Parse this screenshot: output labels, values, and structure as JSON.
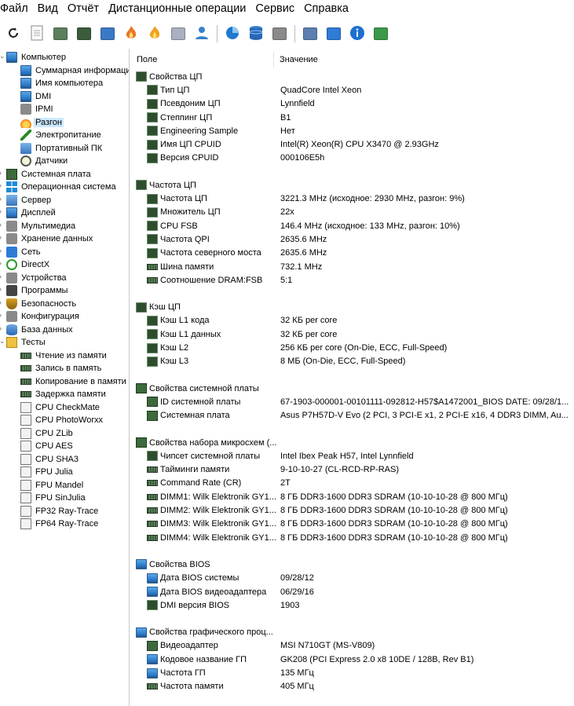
{
  "menu": [
    "Файл",
    "Вид",
    "Отчёт",
    "Дистанционные операции",
    "Сервис",
    "Справка"
  ],
  "toolbar": [
    {
      "icon": "refresh-icon"
    },
    {
      "icon": "report-icon"
    },
    {
      "icon": "chip-icon"
    },
    {
      "icon": "ram-icon"
    },
    {
      "icon": "network-icon"
    },
    {
      "icon": "fire-icon"
    },
    {
      "icon": "flame-icon"
    },
    {
      "icon": "printer-icon"
    },
    {
      "icon": "user-icon"
    },
    {
      "icon": "pie-chart-icon"
    },
    {
      "icon": "database-icon"
    },
    {
      "icon": "calendar-clock-icon"
    },
    {
      "icon": "list-report-icon"
    },
    {
      "icon": "update-icon"
    },
    {
      "icon": "info-icon"
    },
    {
      "icon": "network-check-icon"
    }
  ],
  "tree": [
    {
      "label": "Компьютер",
      "level": 0,
      "icon": "monitor",
      "expand": "v"
    },
    {
      "label": "Суммарная информаци",
      "level": 1,
      "icon": "monitor"
    },
    {
      "label": "Имя компьютера",
      "level": 1,
      "icon": "monitor"
    },
    {
      "label": "DMI",
      "level": 1,
      "icon": "monitor"
    },
    {
      "label": "IPMI",
      "level": 1,
      "icon": "gray"
    },
    {
      "label": "Разгон",
      "level": 1,
      "icon": "fire",
      "selected": true
    },
    {
      "label": "Электропитание",
      "level": 1,
      "icon": "bolt"
    },
    {
      "label": "Портативный ПК",
      "level": 1,
      "icon": "pc"
    },
    {
      "label": "Датчики",
      "level": 1,
      "icon": "clock"
    },
    {
      "label": "Системная плата",
      "level": 0,
      "icon": "board",
      "expand": ">"
    },
    {
      "label": "Операционная система",
      "level": 0,
      "icon": "win",
      "expand": ">"
    },
    {
      "label": "Сервер",
      "level": 0,
      "icon": "pc",
      "expand": ">"
    },
    {
      "label": "Дисплей",
      "level": 0,
      "icon": "monitor",
      "expand": ">"
    },
    {
      "label": "Мультимедиа",
      "level": 0,
      "icon": "gray",
      "expand": ">"
    },
    {
      "label": "Хранение данных",
      "level": 0,
      "icon": "gray",
      "expand": ">"
    },
    {
      "label": "Сеть",
      "level": 0,
      "icon": "blue",
      "expand": ">"
    },
    {
      "label": "DirectX",
      "level": 0,
      "icon": "green-circle",
      "expand": ">"
    },
    {
      "label": "Устройства",
      "level": 0,
      "icon": "gray",
      "expand": ">"
    },
    {
      "label": "Программы",
      "level": 0,
      "icon": "camera",
      "expand": ">"
    },
    {
      "label": "Безопасность",
      "level": 0,
      "icon": "shield",
      "expand": ">"
    },
    {
      "label": "Конфигурация",
      "level": 0,
      "icon": "gray",
      "expand": ">"
    },
    {
      "label": "База данных",
      "level": 0,
      "icon": "db",
      "expand": ">"
    },
    {
      "label": "Тесты",
      "level": 0,
      "icon": "yellow",
      "expand": "v"
    },
    {
      "label": "Чтение из памяти",
      "level": 1,
      "icon": "ram"
    },
    {
      "label": "Запись в память",
      "level": 1,
      "icon": "ram"
    },
    {
      "label": "Копирование в памяти",
      "level": 1,
      "icon": "ram"
    },
    {
      "label": "Задержка памяти",
      "level": 1,
      "icon": "ram"
    },
    {
      "label": "CPU CheckMate",
      "level": 1,
      "icon": "cpu-test"
    },
    {
      "label": "CPU PhotoWorxx",
      "level": 1,
      "icon": "cpu-test"
    },
    {
      "label": "CPU ZLib",
      "level": 1,
      "icon": "cpu-test"
    },
    {
      "label": "CPU AES",
      "level": 1,
      "icon": "cpu-test"
    },
    {
      "label": "CPU SHA3",
      "level": 1,
      "icon": "cpu-test"
    },
    {
      "label": "FPU Julia",
      "level": 1,
      "icon": "fpu-test"
    },
    {
      "label": "FPU Mandel",
      "level": 1,
      "icon": "fpu-test"
    },
    {
      "label": "FPU SinJulia",
      "level": 1,
      "icon": "fpu-test"
    },
    {
      "label": "FP32 Ray-Trace",
      "level": 1,
      "icon": "fpu-test"
    },
    {
      "label": "FP64 Ray-Trace",
      "level": 1,
      "icon": "fpu-test"
    }
  ],
  "columns": {
    "field": "Поле",
    "value": "Значение"
  },
  "groups": [
    {
      "title": "Свойства ЦП",
      "icon": "chip",
      "rows": [
        {
          "field": "Тип ЦП",
          "value": "QuadCore Intel Xeon",
          "icon": "chip"
        },
        {
          "field": "Псевдоним ЦП",
          "value": "Lynnfield",
          "icon": "chip"
        },
        {
          "field": "Степпинг ЦП",
          "value": "B1",
          "icon": "chip"
        },
        {
          "field": "Engineering Sample",
          "value": "Нет",
          "icon": "chip"
        },
        {
          "field": "Имя ЦП CPUID",
          "value": "Intel(R) Xeon(R) CPU X3470 @ 2.93GHz",
          "icon": "chip"
        },
        {
          "field": "Версия CPUID",
          "value": "000106E5h",
          "icon": "chip"
        }
      ]
    },
    {
      "title": "Частота ЦП",
      "icon": "chip",
      "rows": [
        {
          "field": "Частота ЦП",
          "value": "3221.3 MHz  (исходное: 2930 MHz, разгон: 9%)",
          "icon": "chip"
        },
        {
          "field": "Множитель ЦП",
          "value": "22x",
          "icon": "chip"
        },
        {
          "field": "CPU FSB",
          "value": "146.4 MHz  (исходное: 133 MHz, разгон: 10%)",
          "icon": "chip"
        },
        {
          "field": "Частота QPI",
          "value": "2635.6 MHz",
          "icon": "chip"
        },
        {
          "field": "Частота северного моста",
          "value": "2635.6 MHz",
          "icon": "chip"
        },
        {
          "field": "Шина памяти",
          "value": "732.1 MHz",
          "icon": "ram"
        },
        {
          "field": "Соотношение DRAM:FSB",
          "value": "5:1",
          "icon": "ram"
        }
      ]
    },
    {
      "title": "Кэш ЦП",
      "icon": "chip",
      "rows": [
        {
          "field": "Кэш L1 кода",
          "value": "32 КБ per core",
          "icon": "chip"
        },
        {
          "field": "Кэш L1 данных",
          "value": "32 КБ per core",
          "icon": "chip"
        },
        {
          "field": "Кэш L2",
          "value": "256 КБ per core  (On-Die, ECC, Full-Speed)",
          "icon": "chip"
        },
        {
          "field": "Кэш L3",
          "value": "8 МБ  (On-Die, ECC, Full-Speed)",
          "icon": "chip"
        }
      ]
    },
    {
      "title": "Свойства системной платы",
      "icon": "board",
      "rows": [
        {
          "field": "ID системной платы",
          "value": "67-1903-000001-00101111-092812-H57$A1472001_BIOS DATE: 09/28/1...",
          "icon": "board"
        },
        {
          "field": "Системная плата",
          "value": "Asus P7H57D-V Evo  (2 PCI, 3 PCI-E x1, 2 PCI-E x16, 4 DDR3 DIMM, Au...",
          "icon": "board"
        }
      ]
    },
    {
      "title": "Свойства набора микросхем (...",
      "icon": "board",
      "rows": [
        {
          "field": "Чипсет системной платы",
          "value": "Intel Ibex Peak H57, Intel Lynnfield",
          "icon": "chip"
        },
        {
          "field": "Тайминги памяти",
          "value": "9-10-10-27  (CL-RCD-RP-RAS)",
          "icon": "ram"
        },
        {
          "field": "Command Rate (CR)",
          "value": "2T",
          "icon": "ram"
        },
        {
          "field": "DIMM1: Wilk Elektronik GY1...",
          "value": "8 ГБ DDR3-1600 DDR3 SDRAM  (10-10-10-28 @ 800 МГц)",
          "icon": "ram"
        },
        {
          "field": "DIMM2: Wilk Elektronik GY1...",
          "value": "8 ГБ DDR3-1600 DDR3 SDRAM  (10-10-10-28 @ 800 МГц)",
          "icon": "ram"
        },
        {
          "field": "DIMM3: Wilk Elektronik GY1...",
          "value": "8 ГБ DDR3-1600 DDR3 SDRAM  (10-10-10-28 @ 800 МГц)",
          "icon": "ram"
        },
        {
          "field": "DIMM4: Wilk Elektronik GY1...",
          "value": "8 ГБ DDR3-1600 DDR3 SDRAM  (10-10-10-28 @ 800 МГц)",
          "icon": "ram"
        }
      ]
    },
    {
      "title": "Свойства BIOS",
      "icon": "monitor",
      "rows": [
        {
          "field": "Дата BIOS системы",
          "value": "09/28/12",
          "icon": "monitor"
        },
        {
          "field": "Дата BIOS видеоадаптера",
          "value": "06/29/16",
          "icon": "monitor"
        },
        {
          "field": "DMI версия BIOS",
          "value": "1903",
          "icon": "chip"
        }
      ]
    },
    {
      "title": "Свойства графического проц...",
      "icon": "monitor",
      "rows": [
        {
          "field": "Видеоадаптер",
          "value": "MSI N710GT (MS-V809)",
          "icon": "board"
        },
        {
          "field": "Кодовое название ГП",
          "value": "GK208  (PCI Express 2.0 x8 10DE / 128B, Rev B1)",
          "icon": "monitor"
        },
        {
          "field": "Частота ГП",
          "value": "135 МГц",
          "icon": "monitor"
        },
        {
          "field": "Частота памяти",
          "value": "405 МГц",
          "icon": "ram"
        }
      ]
    }
  ]
}
